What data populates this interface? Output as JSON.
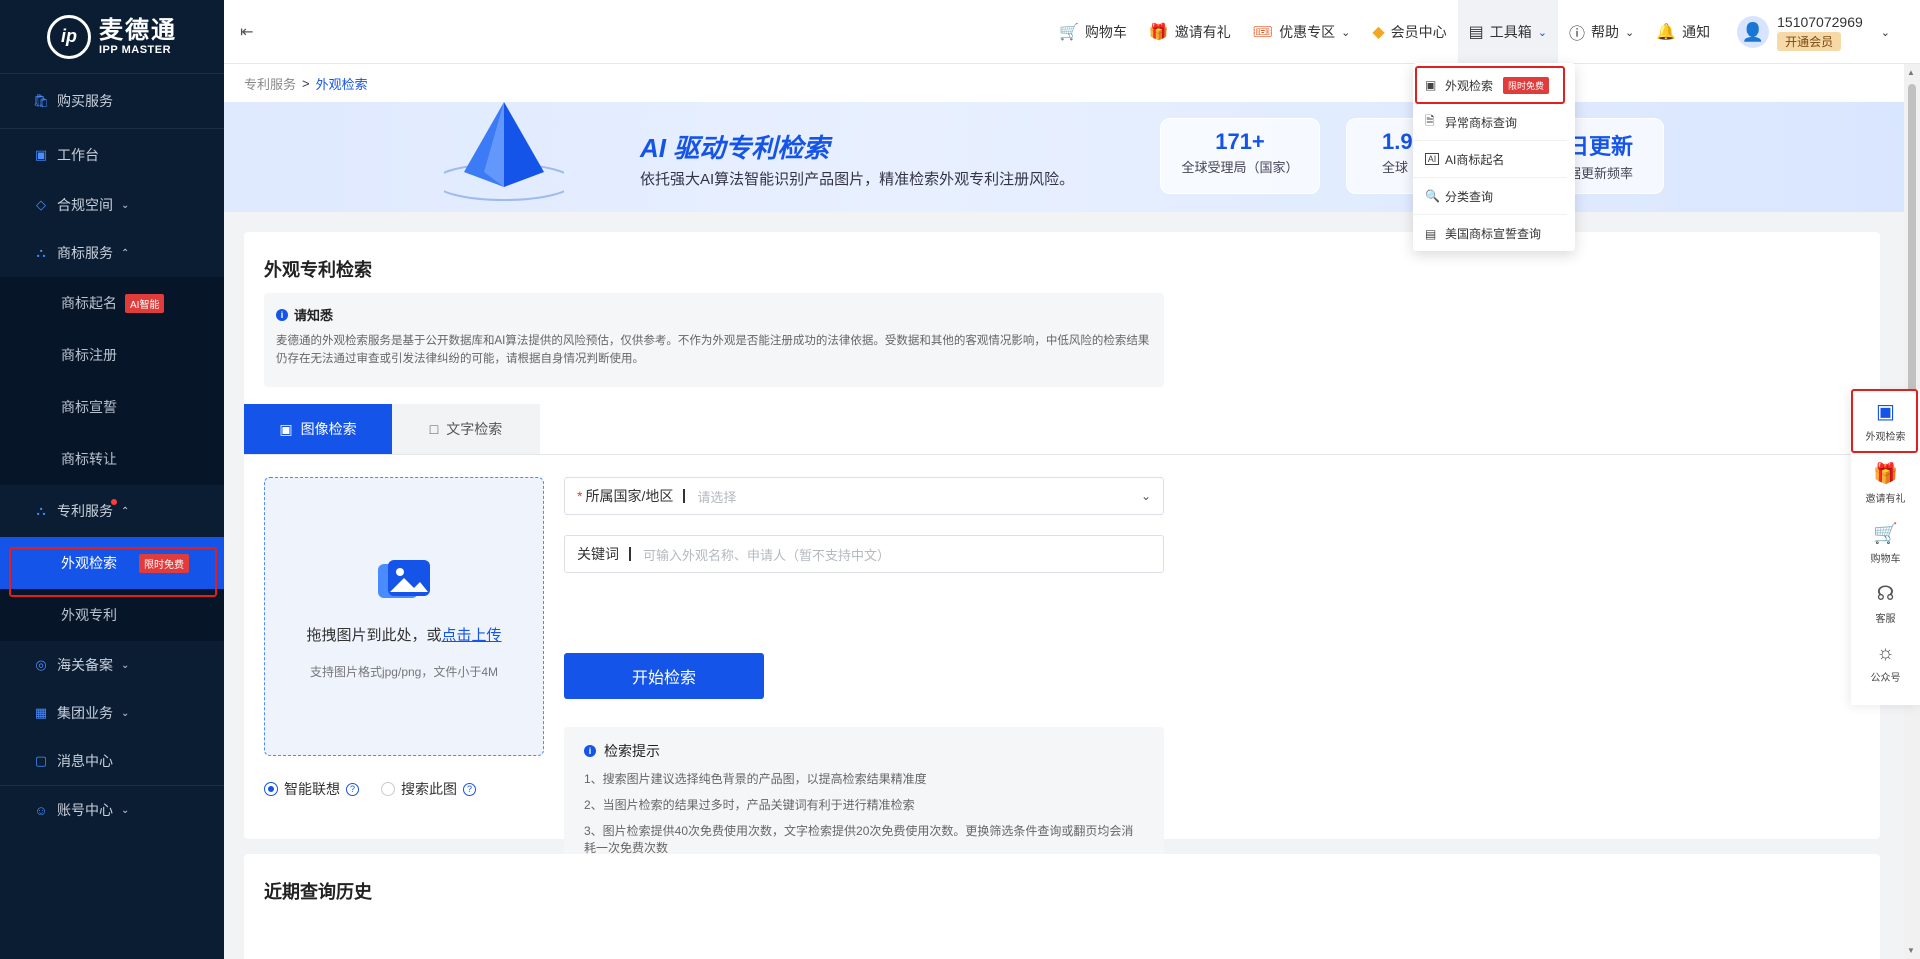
{
  "brand": {
    "cn": "麦德通",
    "en": "IPP MASTER",
    "mark": "ip"
  },
  "sidebar": {
    "items": [
      {
        "label": "购买服务",
        "icon": "bag-icon"
      },
      {
        "label": "工作台",
        "icon": "monitor-icon"
      },
      {
        "label": "合规空间",
        "icon": "cube-icon"
      },
      {
        "label": "商标服务",
        "icon": "shield-icon"
      },
      {
        "label": "专利服务",
        "icon": "patent-icon"
      },
      {
        "label": "海关备案",
        "icon": "globe-icon"
      },
      {
        "label": "集团业务",
        "icon": "building-icon"
      },
      {
        "label": "消息中心",
        "icon": "message-icon"
      },
      {
        "label": "账号中心",
        "icon": "user-icon"
      }
    ],
    "trademark_sub": [
      {
        "label": "商标起名",
        "tag": "AI智能"
      },
      {
        "label": "商标注册"
      },
      {
        "label": "商标宣誓"
      },
      {
        "label": "商标转让"
      }
    ],
    "patent_sub": [
      {
        "label": "外观检索",
        "tag": "限时免费"
      },
      {
        "label": "外观专利"
      }
    ]
  },
  "header": {
    "nav": [
      {
        "label": "购物车",
        "icon": "cart-icon"
      },
      {
        "label": "邀请有礼",
        "icon": "gift-icon"
      },
      {
        "label": "优惠专区",
        "icon": "coupon-icon"
      },
      {
        "label": "会员中心",
        "icon": "diamond-icon"
      },
      {
        "label": "工具箱",
        "icon": "toolbox-icon"
      },
      {
        "label": "帮助",
        "icon": "help-icon"
      },
      {
        "label": "通知",
        "icon": "bell-icon"
      }
    ],
    "user": {
      "phone": "15107072969",
      "vip": "开通会员"
    }
  },
  "toolbox_menu": [
    {
      "label": "外观检索",
      "tag": "限时免费"
    },
    {
      "label": "异常商标查询"
    },
    {
      "label": "AI商标起名"
    },
    {
      "label": "分类查询"
    },
    {
      "label": "美国商标宣誓查询"
    }
  ],
  "breadcrumb": {
    "parent": "专利服务",
    "sep": ">",
    "current": "外观检索"
  },
  "banner": {
    "title": "AI 驱动专利检索",
    "subtitle": "依托强大AI算法智能识别产品图片，精准检索外观专利注册风险。",
    "stats": [
      {
        "num": "171+",
        "label": "全球受理局（国家）"
      },
      {
        "num": "1.9",
        "label": "全球"
      },
      {
        "num": "日更新",
        "label": "数据更新频率"
      }
    ]
  },
  "panel": {
    "title": "外观专利检索",
    "notice_title": "请知悉",
    "notice_text": "麦德通的外观检索服务是基于公开数据库和AI算法提供的风险预估，仅供参考。不作为外观是否能注册成功的法律依据。受数据和其他的客观情况影响，中低风险的检索结果仍存在无法通过审查或引发法律纠纷的可能，请根据自身情况判断使用。",
    "tabs": [
      "图像检索",
      "文字检索"
    ],
    "upload_main": "拖拽图片到此处，或",
    "upload_link": "点击上传",
    "upload_hint": "支持图片格式jpg/png，文件小于4M",
    "radio_smart": "智能联想",
    "radio_search": "搜索此图",
    "country_label": "所属国家/地区",
    "country_placeholder": "请选择",
    "keyword_label": "关键词",
    "keyword_placeholder": "可输入外观名称、申请人（暂不支持中文）",
    "search_btn": "开始检索",
    "tips_title": "检索提示",
    "tips": [
      "1、搜索图片建议选择纯色背景的产品图，以提高检索结果精准度",
      "2、当图片检索的结果过多时，产品关键词有利于进行精准检索",
      "3、图片检索提供40次免费使用次数，文字检索提供20次免费使用次数。更换筛选条件查询或翻页均会消耗一次免费次数"
    ]
  },
  "history": {
    "title": "近期查询历史"
  },
  "floatbar": [
    {
      "label": "外观检索",
      "icon": "patent-search-icon"
    },
    {
      "label": "邀请有礼",
      "icon": "gift-icon"
    },
    {
      "label": "购物车",
      "icon": "cart-icon"
    },
    {
      "label": "客服",
      "icon": "headset-icon"
    },
    {
      "label": "公众号",
      "icon": "wechat-icon"
    }
  ]
}
